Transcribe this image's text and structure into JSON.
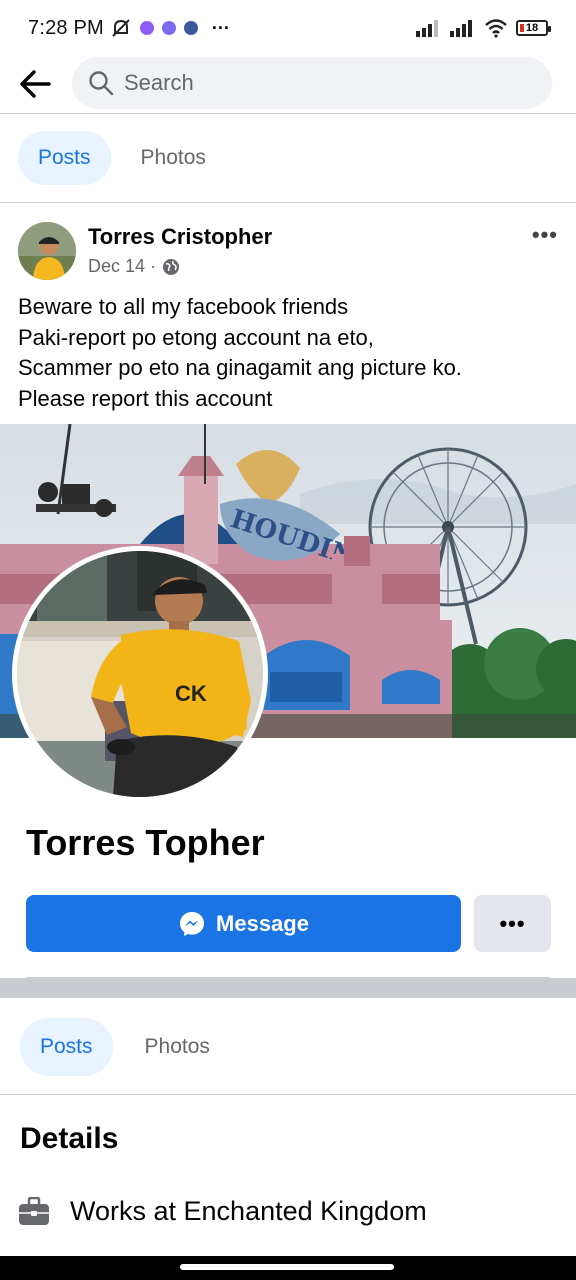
{
  "status_bar": {
    "time": "7:28 PM",
    "battery": "18",
    "more": "···"
  },
  "search": {
    "placeholder": "Search"
  },
  "top_tabs": [
    {
      "label": "Posts",
      "active": true
    },
    {
      "label": "Photos",
      "active": false
    }
  ],
  "post": {
    "author": "Torres Cristopher",
    "date": "Dec 14 ·",
    "privacy_icon": "globe-icon",
    "more_label": "•••",
    "text_lines": [
      "Beware to all my facebook friends",
      "Paki-report po etong account na eto,",
      "Scammer po eto na ginagamit ang picture ko.",
      "Please report this account"
    ]
  },
  "profile": {
    "name": "Torres Topher",
    "message_label": "Message",
    "more_label": "•••",
    "shirt_text": "CK"
  },
  "profile_tabs": [
    {
      "label": "Posts",
      "active": true
    },
    {
      "label": "Photos",
      "active": false
    }
  ],
  "details": {
    "title": "Details",
    "work": "Works at Enchanted Kingdom",
    "work_icon": "briefcase-icon"
  },
  "colors": {
    "accent": "#1b74e4",
    "tab_active_bg": "#e7f3ff",
    "secondary_text": "#65676b"
  }
}
